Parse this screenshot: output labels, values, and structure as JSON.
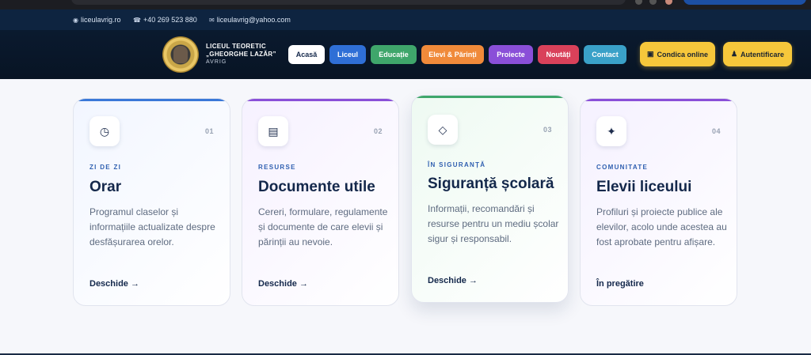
{
  "topbar": {
    "website": "liceulavrig.ro",
    "phone": "+40 269 523 880",
    "email": "liceulavrig@yahoo.com"
  },
  "header": {
    "school_line1": "LICEUL TEORETIC",
    "school_line2": "„GHEORGHE LAZĂR”",
    "city": "AVRIG",
    "nav": [
      {
        "label": "Acasă",
        "color": "#ffffff"
      },
      {
        "label": "Liceul",
        "color": "#2f6fd6"
      },
      {
        "label": "Educație",
        "color": "#3fa66b"
      },
      {
        "label": "Elevi & Părinți",
        "color": "#f08a3a"
      },
      {
        "label": "Proiecte",
        "color": "#8a4fd8"
      },
      {
        "label": "Noutăți",
        "color": "#d9415a"
      },
      {
        "label": "Contact",
        "color": "#3aa1c8"
      }
    ],
    "cta_online": "Condica online",
    "cta_login": "Autentificare"
  },
  "cards": [
    {
      "num": "01",
      "tag": "ZI DE ZI",
      "title": "Orar",
      "desc": "Programul claselor și informațiile actualizate despre desfășurarea orelor.",
      "link": "Deschide →",
      "icon": "clock-icon",
      "accent": "#3a78d8",
      "tagColor": "#2f5fb0"
    },
    {
      "num": "02",
      "tag": "RESURSE",
      "title": "Documente utile",
      "desc": "Cereri, formulare, regulamente și documente de care elevii și părinții au nevoie.",
      "link": "Deschide →",
      "icon": "document-icon",
      "accent": "#8a4fd8",
      "tagColor": "#2f5fb0"
    },
    {
      "num": "03",
      "tag": "ÎN SIGURANȚĂ",
      "title": "Siguranță școlară",
      "desc": "Informații, recomandări și resurse pentru un mediu școlar sigur și responsabil.",
      "link": "Deschide →",
      "icon": "diamond-icon",
      "accent": "#3fa66b",
      "tagColor": "#2f5fb0"
    },
    {
      "num": "04",
      "tag": "COMUNITATE",
      "title": "Elevii liceului",
      "desc": "Profiluri și proiecte publice ale elevilor, acolo unde acestea au fost aprobate pentru afișare.",
      "link": "În pregătire",
      "icon": "sparkle-icon",
      "accent": "#8a4fd8",
      "tagColor": "#2f5fb0"
    }
  ]
}
